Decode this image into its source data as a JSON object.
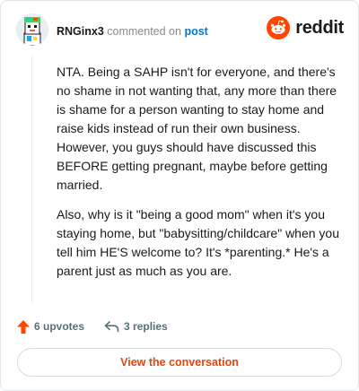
{
  "header": {
    "username": "RNGinx3",
    "action_text": "commented on",
    "post_link_label": "post",
    "brand_word": "reddit"
  },
  "comment": {
    "paragraphs": [
      "NTA. Being a SAHP isn't for everyone, and there's no shame in not wanting that, any more than there is shame for a person wanting to stay home and raise kids instead of run their own business. However, you guys should have discussed this BEFORE getting pregnant, maybe before getting married.",
      "Also, why is it \"being a good mom\" when it's you staying home, but \"babysitting/childcare\" when you tell him HE'S welcome to? It's *parenting.* He's a parent just as much as you are."
    ]
  },
  "footer": {
    "upvotes_label": "6 upvotes",
    "replies_label": "3 replies",
    "cta_label": "View the conversation"
  },
  "colors": {
    "brand_orange": "#ff4500",
    "upvote_orange": "#ff4500",
    "link_blue": "#0079d3",
    "cta_text": "#e2450e",
    "meta_gray": "#878a8c"
  },
  "icons": {
    "avatar": "pixel-avatar",
    "brand": "reddit-snoo-icon",
    "upvote": "upvote-arrow-icon",
    "reply": "reply-arrow-icon"
  }
}
